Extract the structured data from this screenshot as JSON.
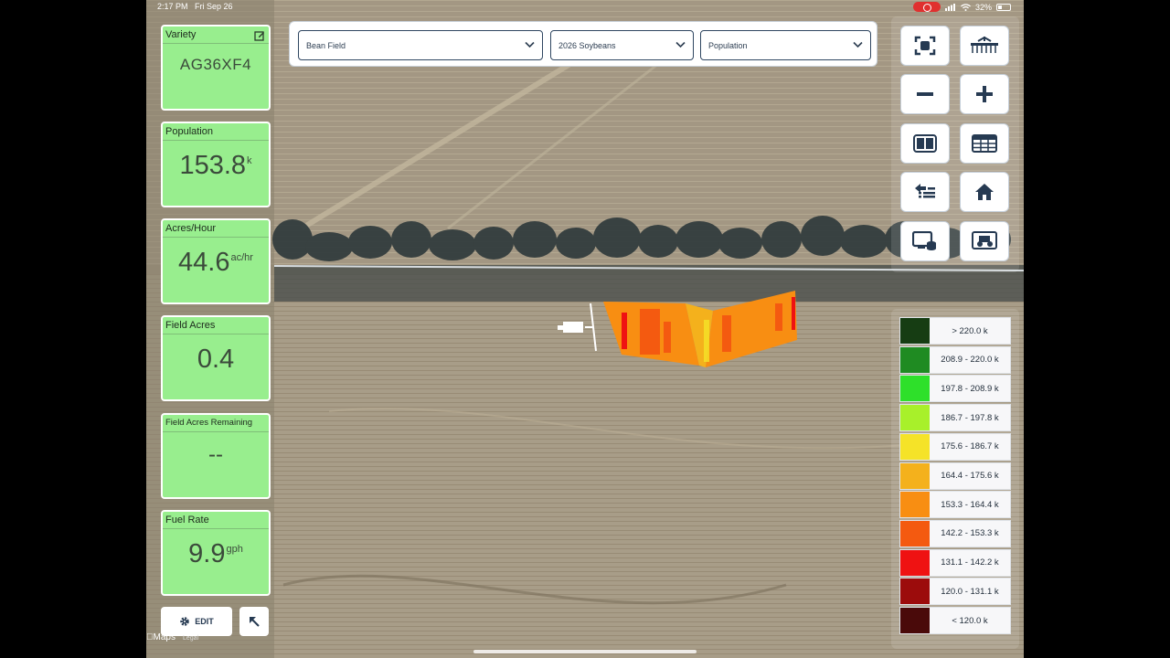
{
  "status_bar": {
    "time": "2:17 PM",
    "date": "Fri Sep 26",
    "battery": "32%"
  },
  "metrics": [
    {
      "title": "Variety",
      "value": "AG36XF4",
      "unit": ""
    },
    {
      "title": "Population",
      "value": "153.8",
      "unit": "k"
    },
    {
      "title": "Acres/Hour",
      "value": "44.6",
      "unit": "ac/hr"
    },
    {
      "title": "Field Acres",
      "value": "0.4",
      "unit": ""
    },
    {
      "title": "Field Acres Remaining",
      "value": "--",
      "unit": ""
    },
    {
      "title": "Fuel Rate",
      "value": "9.9",
      "unit": "gph"
    }
  ],
  "edit_button": {
    "label": "EDIT"
  },
  "map_attribution": {
    "logo": "Maps",
    "legal": "Legal"
  },
  "dropdowns": {
    "field": "Bean Field",
    "season": "2026 Soybeans",
    "layer": "Population"
  },
  "legend": [
    {
      "label": "> 220.0 k",
      "color": "#163d13"
    },
    {
      "label": "208.9 - 220.0 k",
      "color": "#1f8b22"
    },
    {
      "label": "197.8 - 208.9 k",
      "color": "#2ee02a"
    },
    {
      "label": "186.7 - 197.8 k",
      "color": "#a8f02a"
    },
    {
      "label": "175.6 - 186.7 k",
      "color": "#f5e328"
    },
    {
      "label": "164.4 - 175.6 k",
      "color": "#f4b11c"
    },
    {
      "label": "153.3 - 164.4 k",
      "color": "#f88e12"
    },
    {
      "label": "142.2 - 153.3 k",
      "color": "#f45a10"
    },
    {
      "label": "131.1 - 142.2 k",
      "color": "#ef1212"
    },
    {
      "label": "120.0 - 131.1 k",
      "color": "#9c0c0c"
    },
    {
      "label": "< 120.0 k",
      "color": "#4a0a0a"
    }
  ]
}
